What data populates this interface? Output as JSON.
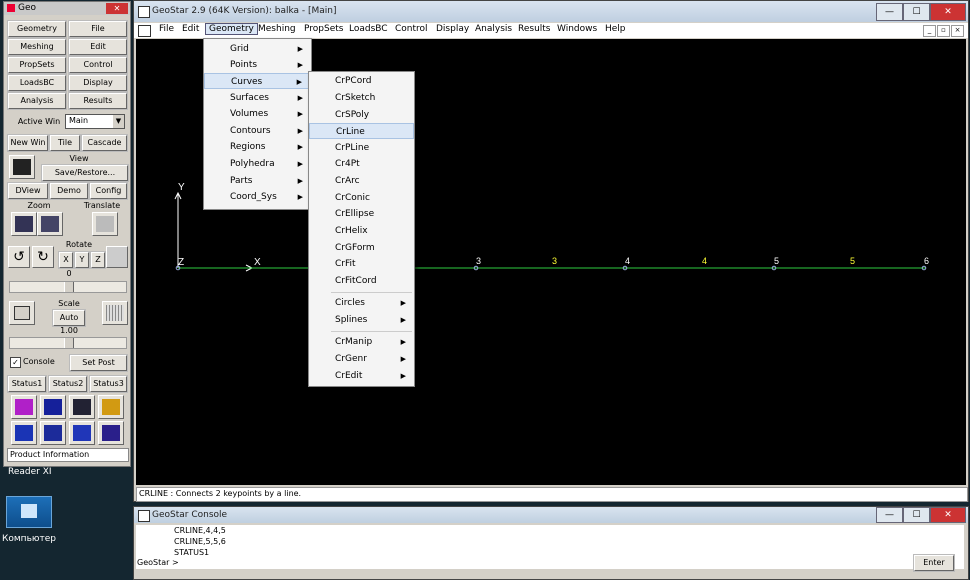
{
  "desktop": {
    "icon_label": "Компьютер",
    "partial_label": "Reader XI"
  },
  "panel": {
    "title": "Geo",
    "close": "✕",
    "buttons": [
      [
        "Geometry",
        "File"
      ],
      [
        "Meshing",
        "Edit"
      ],
      [
        "PropSets",
        "Control"
      ],
      [
        "LoadsBC",
        "Display"
      ],
      [
        "Analysis",
        "Results"
      ]
    ],
    "active_win_label": "Active Win",
    "active_win_value": "Main",
    "row_win": [
      "New Win",
      "Tile",
      "Cascade"
    ],
    "view_label": "View",
    "save_restore": "Save/Restore...",
    "row_dview": [
      "DView",
      "Demo",
      "Config"
    ],
    "zoom_label": "Zoom",
    "translate_label": "Translate",
    "rotate_label": "Rotate",
    "axis_buttons": [
      "X",
      "Y",
      "Z"
    ],
    "rotate_value": "0",
    "scale_label": "Scale",
    "auto": "Auto",
    "scale_value": "1.00",
    "console_label": "Console",
    "set_post": "Set Post",
    "status_buttons": [
      "Status1",
      "Status2",
      "Status3"
    ],
    "product_info": "Product Information"
  },
  "main": {
    "title": "GeoStar 2.9 (64K Version): balka - [Main]",
    "win_buttons": [
      "—",
      "☐",
      "✕"
    ],
    "menus": [
      "File",
      "Edit",
      "Geometry",
      "Meshing",
      "PropSets",
      "LoadsBC",
      "Control",
      "Display",
      "Analysis",
      "Results",
      "Windows",
      "Help"
    ],
    "mdi_buttons": [
      "_",
      "▫",
      "×"
    ],
    "status_text": "CRLINE : Connects 2 keypoints by a line."
  },
  "geometry_menu": [
    {
      "label": "Grid",
      "sub": true
    },
    {
      "label": "Points",
      "sub": true
    },
    {
      "label": "Curves",
      "sub": true,
      "active": true
    },
    {
      "label": "Surfaces",
      "sub": true
    },
    {
      "label": "Volumes",
      "sub": true
    },
    {
      "label": "Contours",
      "sub": true
    },
    {
      "label": "Regions",
      "sub": true
    },
    {
      "label": "Polyhedra",
      "sub": true
    },
    {
      "label": "Parts",
      "sub": true
    },
    {
      "label": "Coord_Sys",
      "sub": true
    }
  ],
  "curves_menu": {
    "group1": [
      "CrPCord",
      "CrSketch",
      "CrSPoly",
      "CrLine",
      "CrPLine",
      "Cr4Pt",
      "CrArc",
      "CrConic",
      "CrEllipse",
      "CrHelix",
      "CrGForm",
      "CrFit",
      "CrFitCord"
    ],
    "highlighted": "CrLine",
    "group2": [
      "Circles",
      "Splines"
    ],
    "group3": [
      "CrManip",
      "CrGenr",
      "CrEdit"
    ]
  },
  "scene": {
    "axis_y": "Y",
    "axis_x": "X",
    "axis_z": "Z",
    "keypoint_labels": [
      "3",
      "4",
      "5",
      "6"
    ],
    "curve_labels": [
      "3",
      "4",
      "5"
    ],
    "line_color": "#2ecc40",
    "point_label_color": "#ffffff",
    "curve_label_color": "#ffff33"
  },
  "console": {
    "title": "GeoStar Console",
    "win_buttons": [
      "—",
      "☐",
      "✕"
    ],
    "lines": [
      "CRLINE,4,4,5",
      "CRLINE,5,5,6",
      "STATUS1"
    ],
    "prompt": "GeoStar >",
    "enter": "Enter"
  }
}
